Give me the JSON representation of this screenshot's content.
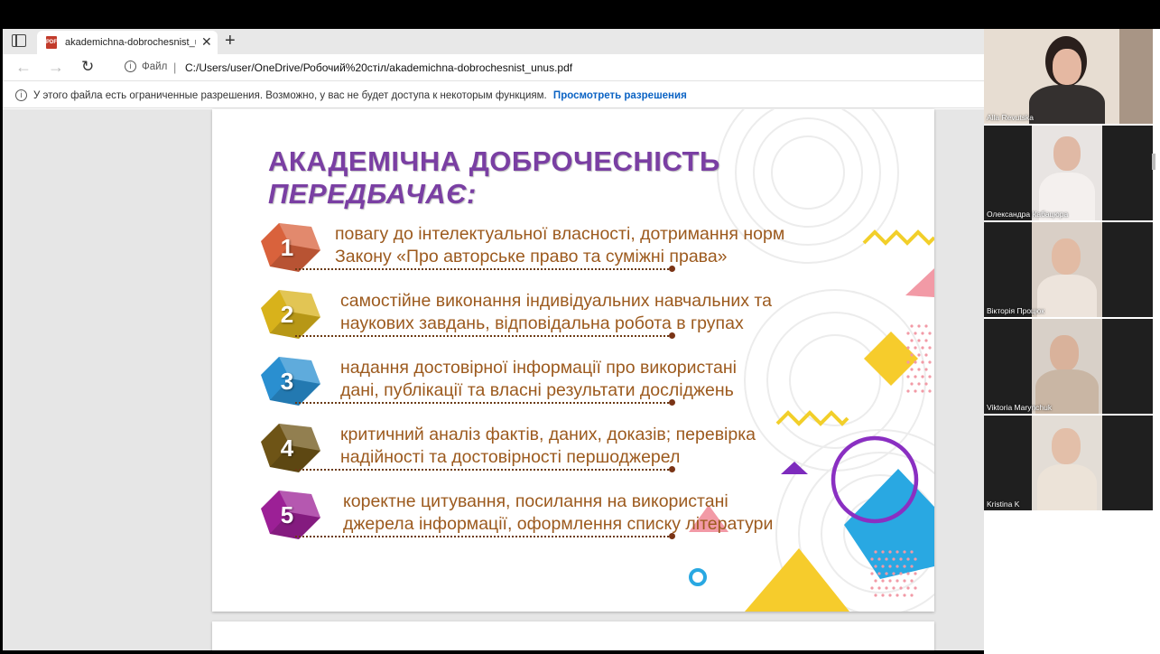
{
  "browser": {
    "tab_title": "akademichna-dobrochesnist_unus",
    "new_tab_symbol": "+",
    "close_symbol": "✕",
    "pdf_badge": "PDF",
    "address_prefix": "Файл",
    "address_separator": "|",
    "address_url": "C:/Users/user/OneDrive/Робочий%20стіл/akademichna-dobrochesnist_unus.pdf",
    "permission_text": "У этого файла есть ограниченные разрешения. Возможно, у вас не будет доступа к некоторым функциям.",
    "permission_link": "Просмотреть разрешения"
  },
  "slide": {
    "title_regular": "АКАДЕМІЧНА ДОБРОЧЕСНІСТЬ ",
    "title_italic": "ПЕРЕДБАЧАЄ:",
    "items": [
      {
        "num": "1",
        "color": "#d9623c",
        "line1": "повагу до інтелектуальної власності, дотримання норм",
        "line2": "Закону «Про авторське право та суміжні права»"
      },
      {
        "num": "2",
        "color": "#d8b21b",
        "line1": "самостійне виконання індивідуальних навчальних та",
        "line2": "наукових завдань, відповідальна робота в групах"
      },
      {
        "num": "3",
        "color": "#2a8fd0",
        "line1": "надання достовірної інформації про використані",
        "line2": "дані, публікації та власні результати досліджень"
      },
      {
        "num": "4",
        "color": "#6e5416",
        "line1": "критичний аналіз фактів, даних, доказів; перевірка",
        "line2": "надійності та достовірності першоджерел"
      },
      {
        "num": "5",
        "color": "#9c2096",
        "line1": "коректне цитування, посилання на використані",
        "line2": "джерела інформації, оформлення списку літератури"
      }
    ]
  },
  "participants": [
    {
      "name": "Alla Revutska"
    },
    {
      "name": "Олександра Кабацюра"
    },
    {
      "name": "Вікторія Процюк"
    },
    {
      "name": "Viktoria Marynchuk"
    },
    {
      "name": "Kristina K"
    }
  ],
  "colors": {
    "title": "#7a3fa3",
    "item_text": "#9c5a1e",
    "link": "#0b63c4"
  }
}
